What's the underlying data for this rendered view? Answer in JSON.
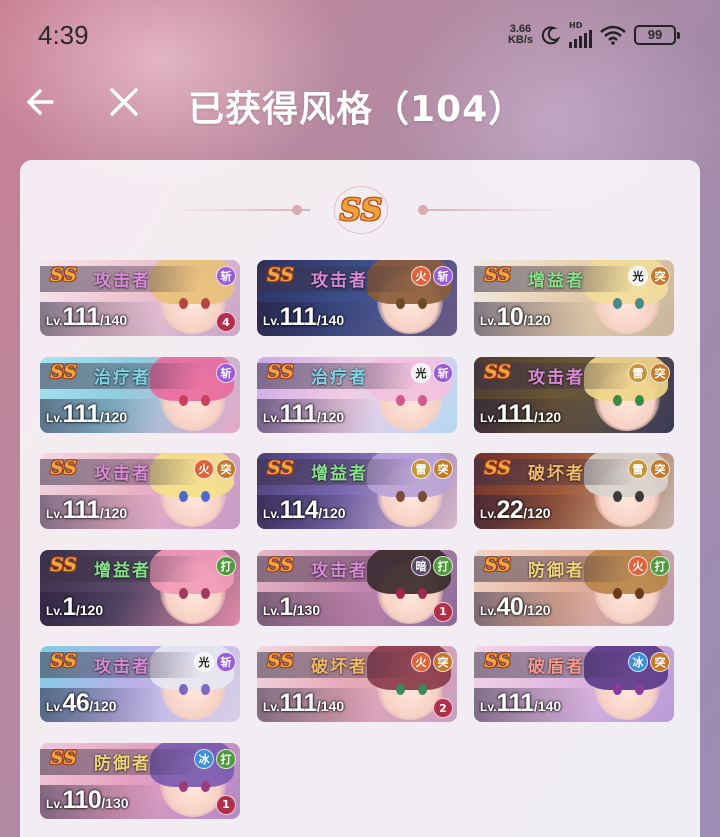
{
  "status": {
    "time": "4:39",
    "net_speed_value": "3.66",
    "net_speed_unit": "KB/s",
    "hd": "HD",
    "battery": "99"
  },
  "header": {
    "title": "已获得风格（104）",
    "back_icon": "arrow-left-icon",
    "close_icon": "close-icon"
  },
  "panel": {
    "rank_label": "SS"
  },
  "colors": {
    "fire": "#e0613a",
    "slash": "#9a5bd6",
    "light": "#f3f3f3",
    "thunder": "#c8963a",
    "pierce": "#c27b2e",
    "strike": "#4f9a3d",
    "dark": "#5a4a6a",
    "ice": "#3f8fd6"
  },
  "cards": [
    {
      "ss": "SS",
      "role": "攻击者",
      "role_type": "attacker",
      "badges": [
        {
          "t": "斩",
          "k": "slash"
        }
      ],
      "lv_pre": "Lv.",
      "lv": "111",
      "lv_max": "/140",
      "count": "4",
      "art": "a1"
    },
    {
      "ss": "SS",
      "role": "攻击者",
      "role_type": "attacker",
      "badges": [
        {
          "t": "火",
          "k": "fire"
        },
        {
          "t": "斩",
          "k": "slash"
        }
      ],
      "lv_pre": "Lv.",
      "lv": "111",
      "lv_max": "/140",
      "count": "",
      "art": "a2"
    },
    {
      "ss": "SS",
      "role": "增益者",
      "role_type": "buffer",
      "badges": [
        {
          "t": "光",
          "k": "light"
        },
        {
          "t": "突",
          "k": "pierce"
        }
      ],
      "lv_pre": "Lv.",
      "lv": "10",
      "lv_max": "/120",
      "count": "",
      "art": "a3"
    },
    {
      "ss": "SS",
      "role": "治疗者",
      "role_type": "healer",
      "badges": [
        {
          "t": "斩",
          "k": "slash"
        }
      ],
      "lv_pre": "Lv.",
      "lv": "111",
      "lv_max": "/120",
      "count": "",
      "art": "a4"
    },
    {
      "ss": "SS",
      "role": "治疗者",
      "role_type": "healer",
      "badges": [
        {
          "t": "光",
          "k": "light"
        },
        {
          "t": "斩",
          "k": "slash"
        }
      ],
      "lv_pre": "Lv.",
      "lv": "111",
      "lv_max": "/120",
      "count": "",
      "art": "a5"
    },
    {
      "ss": "SS",
      "role": "攻击者",
      "role_type": "attacker",
      "badges": [
        {
          "t": "雷",
          "k": "thunder"
        },
        {
          "t": "突",
          "k": "pierce"
        }
      ],
      "lv_pre": "Lv.",
      "lv": "111",
      "lv_max": "/120",
      "count": "",
      "art": "a6"
    },
    {
      "ss": "SS",
      "role": "攻击者",
      "role_type": "attacker",
      "badges": [
        {
          "t": "火",
          "k": "fire"
        },
        {
          "t": "突",
          "k": "pierce"
        }
      ],
      "lv_pre": "Lv.",
      "lv": "111",
      "lv_max": "/120",
      "count": "",
      "art": "a7"
    },
    {
      "ss": "SS",
      "role": "增益者",
      "role_type": "buffer",
      "badges": [
        {
          "t": "雷",
          "k": "thunder"
        },
        {
          "t": "突",
          "k": "pierce"
        }
      ],
      "lv_pre": "Lv.",
      "lv": "114",
      "lv_max": "/120",
      "count": "",
      "art": "a8"
    },
    {
      "ss": "SS",
      "role": "破坏者",
      "role_type": "breaker",
      "badges": [
        {
          "t": "雷",
          "k": "thunder"
        },
        {
          "t": "突",
          "k": "pierce"
        }
      ],
      "lv_pre": "Lv.",
      "lv": "22",
      "lv_max": "/120",
      "count": "",
      "art": "a9"
    },
    {
      "ss": "SS",
      "role": "增益者",
      "role_type": "buffer",
      "badges": [
        {
          "t": "打",
          "k": "strike"
        }
      ],
      "lv_pre": "Lv.",
      "lv": "1",
      "lv_max": "/120",
      "count": "",
      "art": "a10"
    },
    {
      "ss": "SS",
      "role": "攻击者",
      "role_type": "attacker",
      "badges": [
        {
          "t": "暗",
          "k": "dark"
        },
        {
          "t": "打",
          "k": "strike"
        }
      ],
      "lv_pre": "Lv.",
      "lv": "1",
      "lv_max": "/130",
      "count": "1",
      "art": "a11"
    },
    {
      "ss": "SS",
      "role": "防御者",
      "role_type": "defender",
      "badges": [
        {
          "t": "火",
          "k": "fire"
        },
        {
          "t": "打",
          "k": "strike"
        }
      ],
      "lv_pre": "Lv.",
      "lv": "40",
      "lv_max": "/120",
      "count": "",
      "art": "a12"
    },
    {
      "ss": "SS",
      "role": "攻击者",
      "role_type": "attacker",
      "badges": [
        {
          "t": "光",
          "k": "light"
        },
        {
          "t": "斩",
          "k": "slash"
        }
      ],
      "lv_pre": "Lv.",
      "lv": "46",
      "lv_max": "/120",
      "count": "",
      "art": "a13"
    },
    {
      "ss": "SS",
      "role": "破坏者",
      "role_type": "breaker",
      "badges": [
        {
          "t": "火",
          "k": "fire"
        },
        {
          "t": "突",
          "k": "pierce"
        }
      ],
      "lv_pre": "Lv.",
      "lv": "111",
      "lv_max": "/140",
      "count": "2",
      "art": "a14"
    },
    {
      "ss": "SS",
      "role": "破盾者",
      "role_type": "shield",
      "badges": [
        {
          "t": "冰",
          "k": "ice"
        },
        {
          "t": "突",
          "k": "pierce"
        }
      ],
      "lv_pre": "Lv.",
      "lv": "111",
      "lv_max": "/140",
      "count": "",
      "art": "a15"
    },
    {
      "ss": "SS",
      "role": "防御者",
      "role_type": "defender",
      "badges": [
        {
          "t": "冰",
          "k": "ice"
        },
        {
          "t": "打",
          "k": "strike"
        }
      ],
      "lv_pre": "Lv.",
      "lv": "110",
      "lv_max": "/130",
      "count": "1",
      "art": "a16"
    }
  ]
}
